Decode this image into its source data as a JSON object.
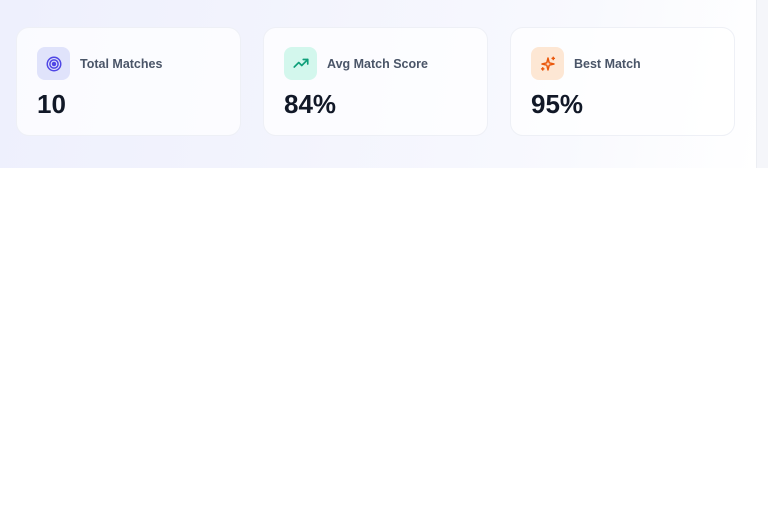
{
  "stats": [
    {
      "label": "Total Matches",
      "value": "10",
      "icon": "target-icon",
      "icon_color": "#4f46e5",
      "tile_color": "#e0e3fb"
    },
    {
      "label": "Avg Match Score",
      "value": "84%",
      "icon": "trending-up-icon",
      "icon_color": "#0f9f7a",
      "tile_color": "#d3f7ed"
    },
    {
      "label": "Best Match",
      "value": "95%",
      "icon": "sparkles-icon",
      "icon_color": "#ea580c",
      "tile_color": "#fde7d4"
    }
  ],
  "colors": {
    "hero_gradient_start": "#eef0fd",
    "text_primary": "#111827",
    "text_secondary": "#4a5568"
  }
}
